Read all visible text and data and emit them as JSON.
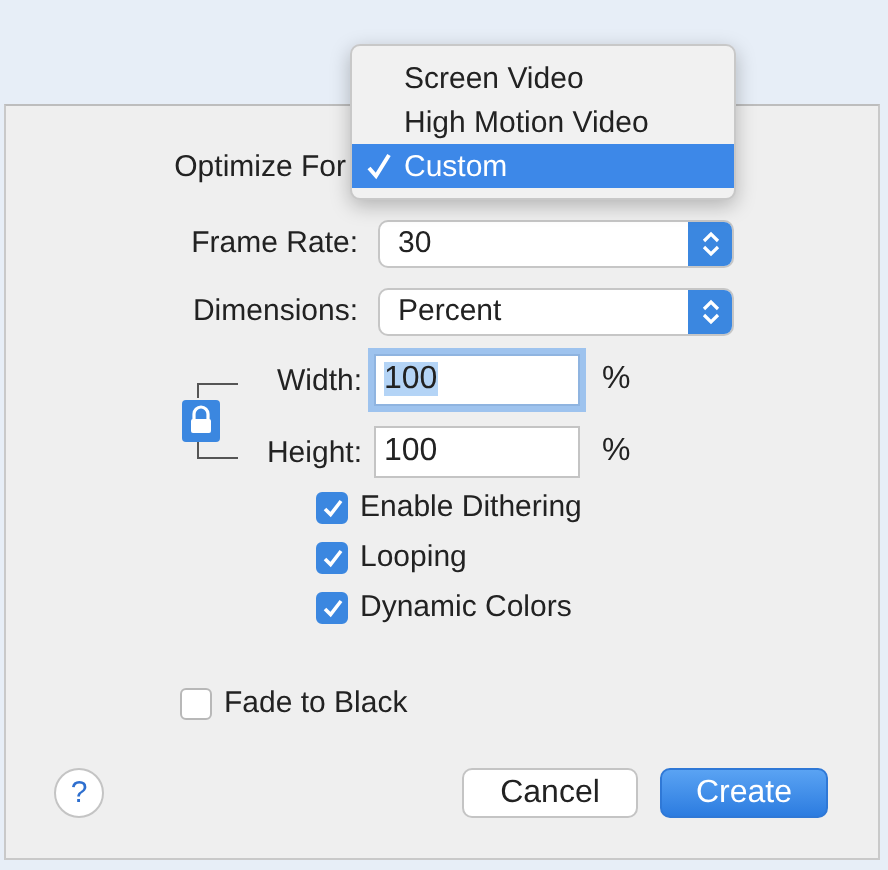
{
  "optimize_for": {
    "label": "Optimize For",
    "menu": [
      {
        "label": "Screen Video",
        "selected": false
      },
      {
        "label": "High Motion Video",
        "selected": false
      },
      {
        "label": "Custom",
        "selected": true
      }
    ]
  },
  "frame_rate": {
    "label": "Frame Rate:",
    "value": "30"
  },
  "dimensions": {
    "label": "Dimensions:",
    "value": "Percent"
  },
  "size_fields": [
    {
      "label": "Width:",
      "value": "100",
      "unit": "%",
      "focused": true
    },
    {
      "label": "Height:",
      "value": "100",
      "unit": "%",
      "focused": false
    }
  ],
  "aspect_locked": true,
  "options": [
    {
      "label": "Enable Dithering",
      "checked": true
    },
    {
      "label": "Looping",
      "checked": true
    },
    {
      "label": "Dynamic Colors",
      "checked": true
    }
  ],
  "fade_to_black": {
    "label": "Fade to Black",
    "checked": false
  },
  "help": "?",
  "buttons": [
    {
      "label": "Cancel",
      "default": false
    },
    {
      "label": "Create",
      "default": true
    }
  ]
}
